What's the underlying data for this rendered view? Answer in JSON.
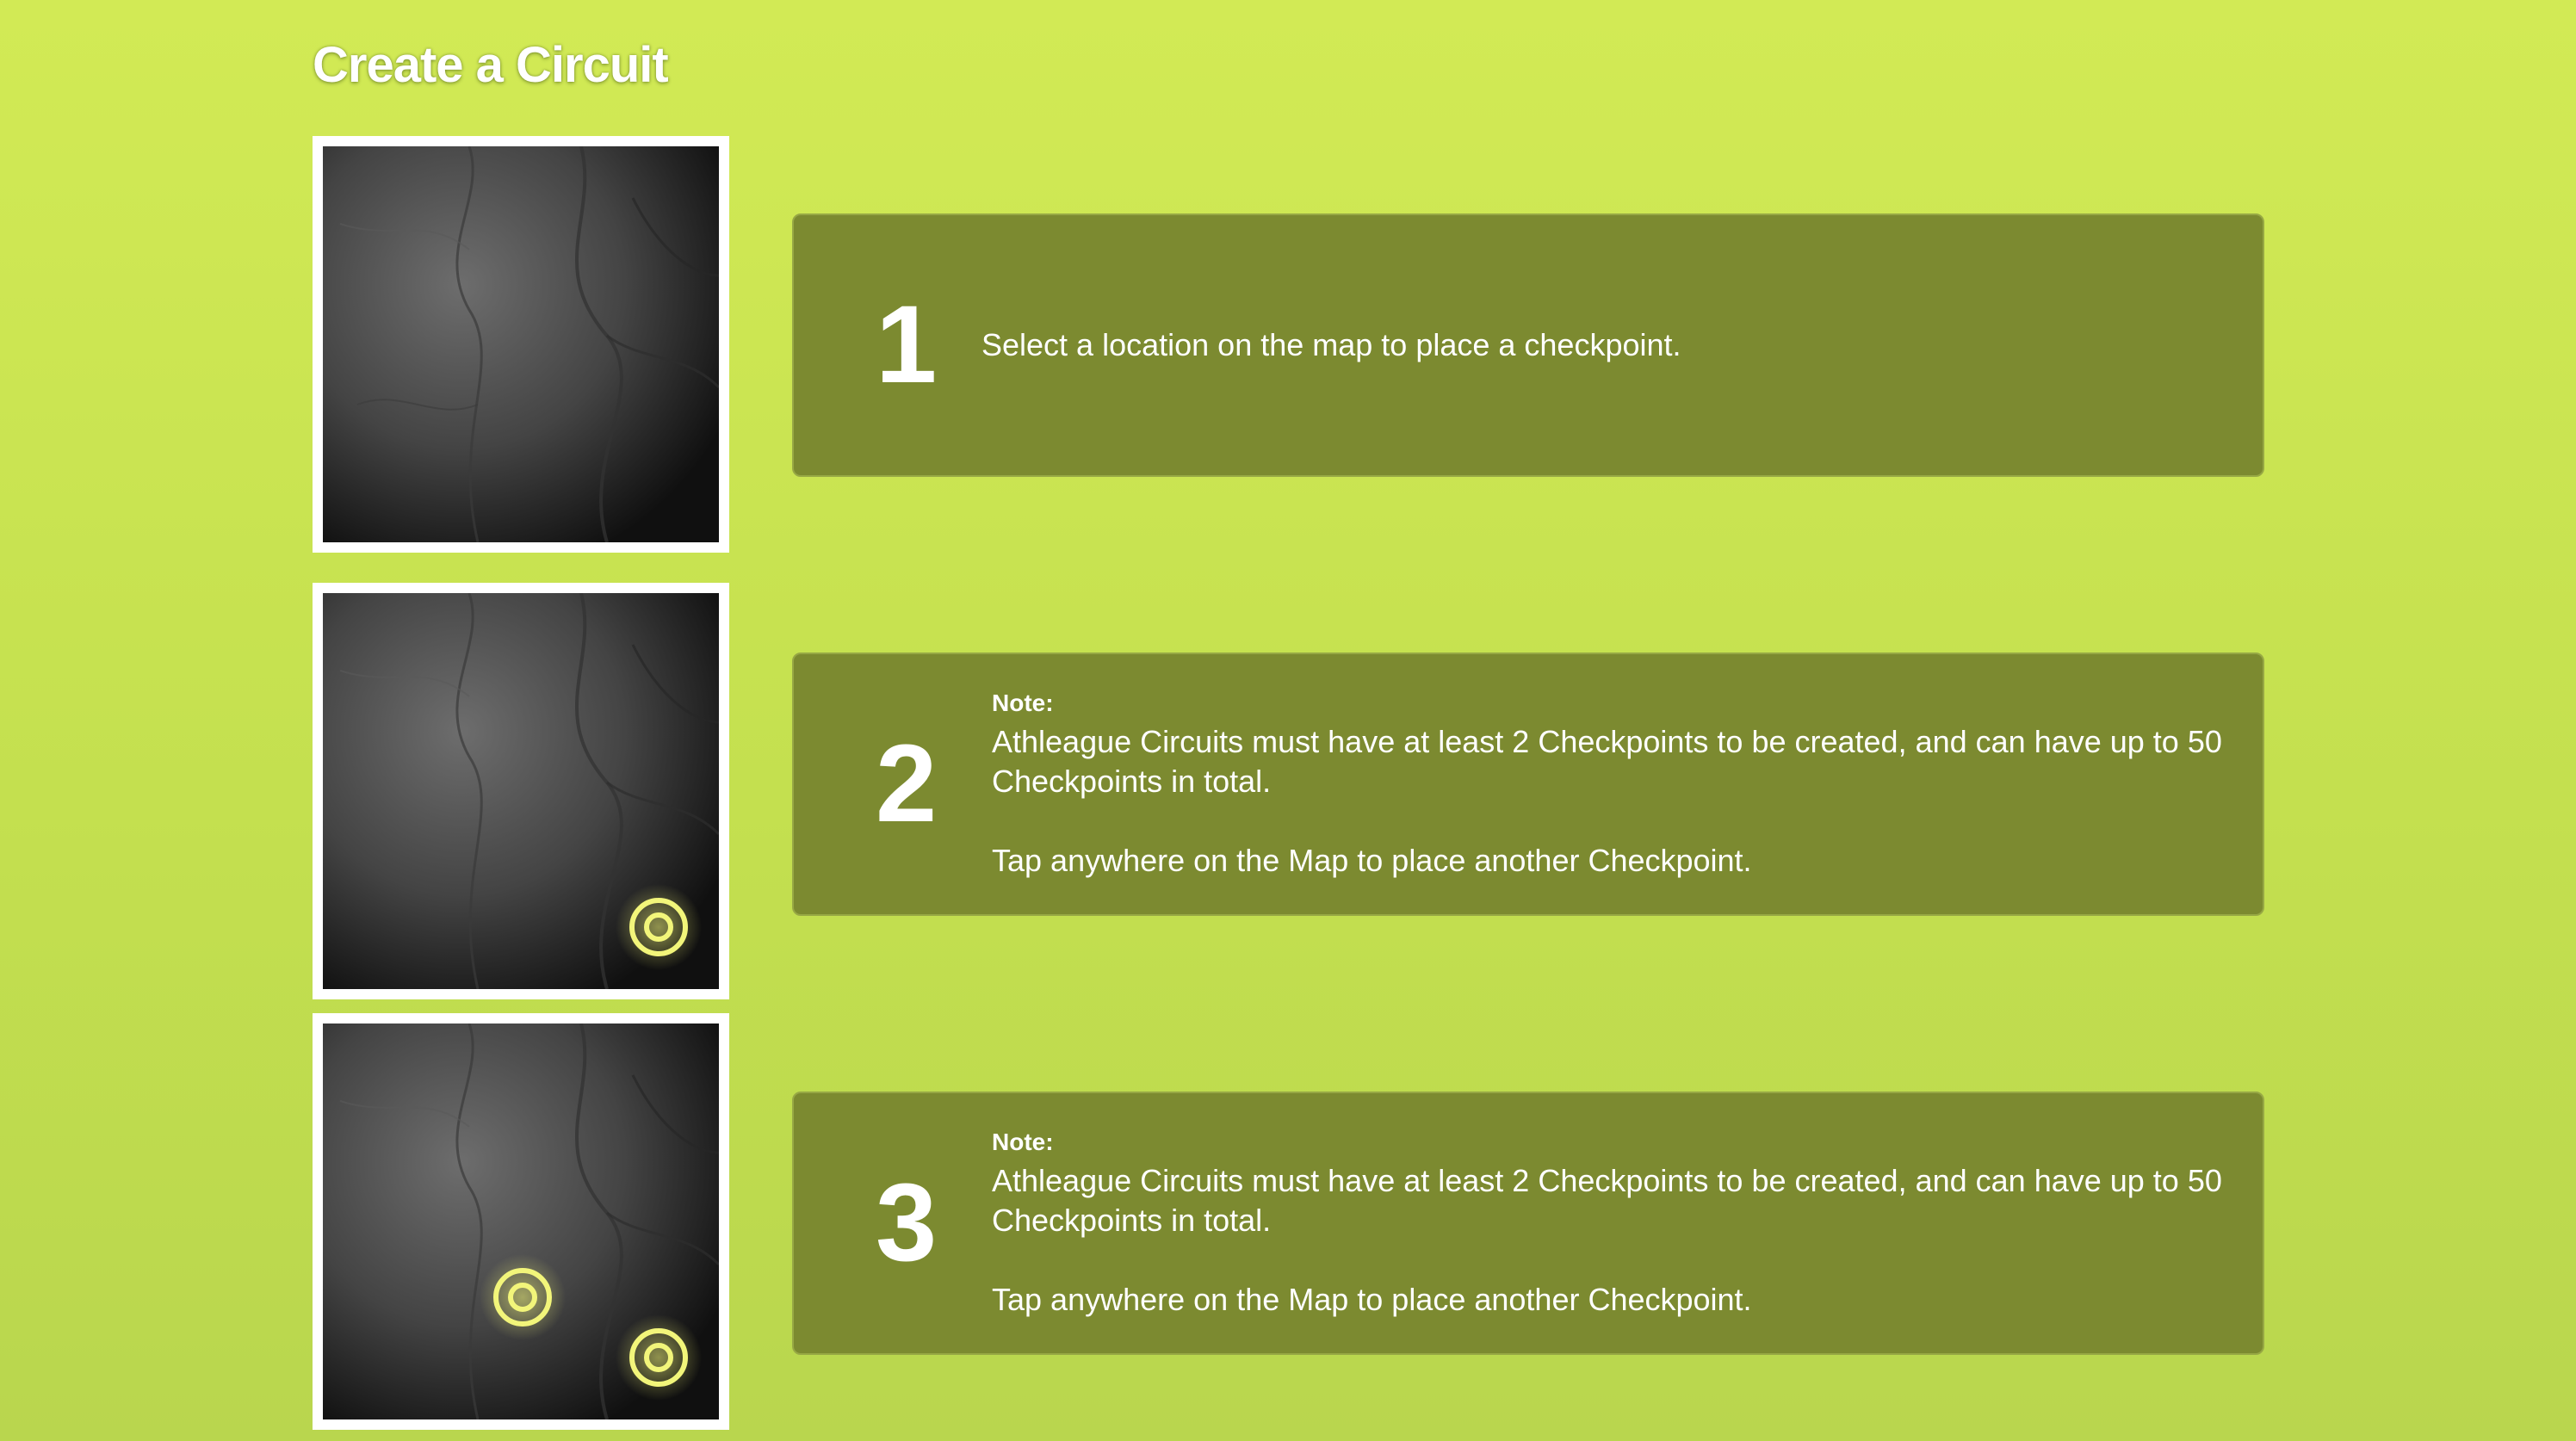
{
  "page": {
    "title": "Create a Circuit"
  },
  "colors": {
    "background_top": "#d2ea55",
    "background_bottom": "#b9d64e",
    "card_background": "#7c8a30",
    "card_text": "#ffffff",
    "checkpoint_marker": "#f2f57a"
  },
  "steps": [
    {
      "number": "1",
      "text": "Select a location on the map to place a checkpoint.",
      "map_checkpoints": 0
    },
    {
      "number": "2",
      "note_label": "Note:",
      "note_text": "Athleague Circuits must have at least 2 Checkpoints to be created, and can have up to 50 Checkpoints in total.",
      "tap_text": "Tap anywhere on the Map to place another Checkpoint.",
      "map_checkpoints": 1
    },
    {
      "number": "3",
      "note_label": "Note:",
      "note_text": "Athleague Circuits must have at least 2 Checkpoints to be created, and can have up to 50 Checkpoints in total.",
      "tap_text": "Tap anywhere on the Map to place another Checkpoint.",
      "map_checkpoints": 2
    }
  ]
}
